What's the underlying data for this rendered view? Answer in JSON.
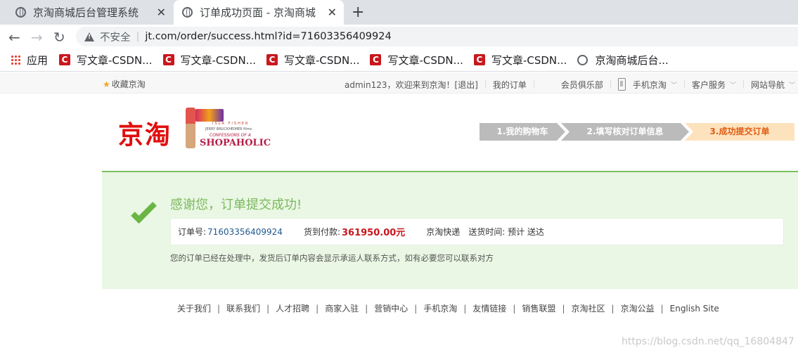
{
  "browser": {
    "tabs": [
      {
        "title": "京淘商城后台管理系统",
        "close": "✕"
      },
      {
        "title": "订单成功页面 - 京淘商城",
        "close": "✕"
      }
    ],
    "new_tab": "+",
    "nav": {
      "back": "←",
      "forward": "→",
      "reload": "↻"
    },
    "security_label": "不安全",
    "url": "jt.com/order/success.html?id=71603356409924",
    "bookmarks": [
      {
        "label": "应用",
        "icon": "apps-grid-icon"
      },
      {
        "label": "写文章-CSDN...",
        "icon": "csdn-icon"
      },
      {
        "label": "写文章-CSDN...",
        "icon": "csdn-icon"
      },
      {
        "label": "写文章-CSDN...",
        "icon": "csdn-icon"
      },
      {
        "label": "写文章-CSDN...",
        "icon": "csdn-icon"
      },
      {
        "label": "写文章-CSDN...",
        "icon": "csdn-icon"
      },
      {
        "label": "京淘商城后台...",
        "icon": "globe-icon"
      }
    ],
    "csdn_glyph": "C"
  },
  "shortcut": {
    "favorite": "收藏京淘",
    "greeting": "admin123，欢迎来到京淘！",
    "logout": "[退出]",
    "my_orders": "我的订单",
    "club": "会员俱乐部",
    "mobile": "手机京淘",
    "service": "客户服务",
    "sitenav": "网站导航"
  },
  "header": {
    "logo": "京淘",
    "banner": {
      "line1": "ISLA FISHER",
      "line2": "JERRY BRUCKHEIMER films",
      "line3": "CONFESSIONS OF A",
      "line4": "SHOPAHOLIC"
    },
    "steps": [
      "1.我的购物车",
      "2.填写核对订单信息",
      "3.成功提交订单"
    ]
  },
  "success": {
    "thanks": "感谢您，订单提交成功!",
    "order_label": "订单号:",
    "order_id": "71603356409924",
    "pay_label": "货到付款:",
    "amount": "361950.00元",
    "courier": "京淘快递",
    "delivery_label": "送货时间: 预计 送达",
    "note": "您的订单已经在处理中，发货后订单内容会显示承运人联系方式，如有必要您可以联系对方"
  },
  "footer": {
    "links": [
      "关于我们",
      "联系我们",
      "人才招聘",
      "商家入驻",
      "营销中心",
      "手机京淘",
      "友情链接",
      "销售联盟",
      "京淘社区",
      "京淘公益",
      "English Site"
    ],
    "separator": "|"
  },
  "watermark": "https://blog.csdn.net/qq_16804847",
  "colors": {
    "logo_red": "#e10e0e",
    "success_green": "#7bb85d",
    "amount_red": "#c8161d",
    "order_blue": "#1f5a8f",
    "step_active": "#e05c14"
  }
}
